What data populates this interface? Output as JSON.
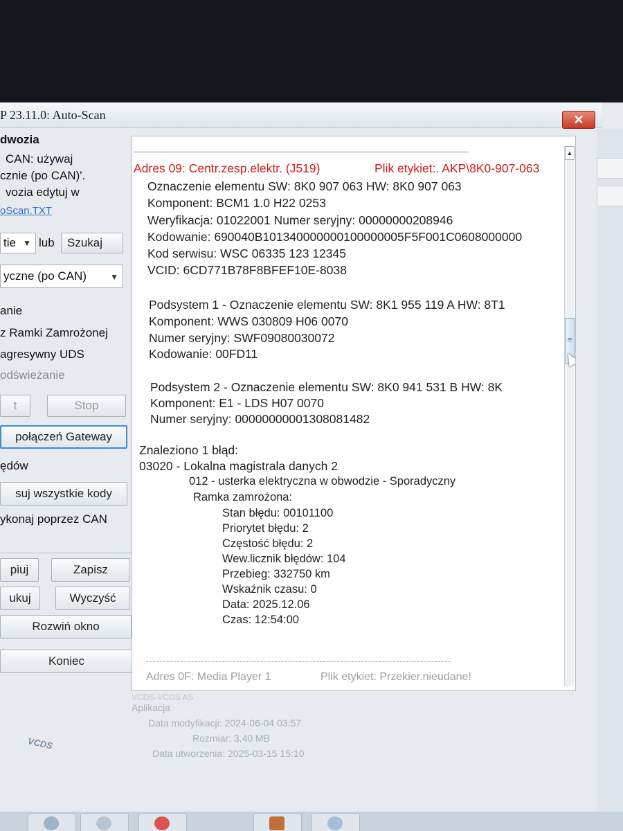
{
  "window": {
    "title": "P 23.11.0:  Auto-Scan",
    "close_symbol": "✕"
  },
  "left_panel": {
    "section_header": "dwozia",
    "info_lines": [
      "CAN: używaj",
      "cznie (po CAN)'.",
      "vozia edytuj w"
    ],
    "info_link": "oScan.TXT",
    "type_select": {
      "value": "tie"
    },
    "or_label": "lub",
    "search_button": "Szukaj",
    "protocol_select": {
      "value": "yczne (po CAN)"
    },
    "options_header": "anie",
    "options": [
      "z Ramki Zamrożonej",
      "agresywny UDS"
    ],
    "refresh_label": "odświeżanie",
    "start_button": "t",
    "stop_button": "Stop",
    "gateway_button": "połączeń Gateway",
    "errors_header": "ędów",
    "clear_all_button": "suj wszystkie kody",
    "via_can_label": "ykonaj poprzez CAN",
    "copy_button": "piuj",
    "save_button": "Zapisz",
    "print_button": "ukuj",
    "clear_button": "Wyczyść",
    "expand_button": "Rozwiń okno",
    "exit_button": "Koniec"
  },
  "report": {
    "header_address": "Adres 09: Centr.zesp.elektr. (J519)",
    "header_label_file": "Plik etykiet:. AKP\\8K0-907-063",
    "lines": [
      "Oznaczenie elementu SW: 8K0 907 063    HW: 8K0 907 063",
      "Komponent: BCM1 1.0      H22 0253",
      "Weryfikacja: 01022001    Numer seryjny: 00000000208946",
      "Kodowanie: 690040B101340000000100000005F5F001C0608000000",
      "Kod serwisu: WSC 06335 123 12345",
      "VCID: 6CD771B78F8BFEF10E-8038"
    ],
    "subsystem1": [
      "Podsystem 1 - Oznaczenie elementu SW: 8K1 955 119 A    HW: 8T1",
      "Komponent: WWS 030809  H06 0070",
      "Numer seryjny: SWF09080030072",
      "Kodowanie: 00FD11"
    ],
    "subsystem2": [
      "Podsystem 2 - Oznaczenie elementu SW: 8K0 941 531 B    HW: 8K",
      "Komponent: E1 - LDS  H07 0070",
      "Numer seryjny: 00000000001308081482"
    ],
    "found_errors": "Znaleziono 1 błąd:",
    "fault_code": "03020 - Lokalna magistrala danych 2",
    "fault_detail": "012 - usterka elektryczna w obwodzie - Sporadyczny",
    "freeze_frame_header": "Ramka zamrożona:",
    "freeze_frame": [
      "Stan błędu: 00101100",
      "Priorytet błędu: 2",
      "Częstość błędu: 2",
      "Wew.licznik błędów: 104",
      "Przebieg: 332750 km",
      "Wskaźnik czasu: 0",
      "Data: 2025.12.06",
      "Czas: 12:54:00"
    ],
    "next_address": "Adres 0F: Media Player 1",
    "next_label_file": "Plik etykiet: Przekier.nieudane!"
  },
  "file_info": {
    "truncated_name": "VCDS-VCDS AS",
    "type": "Aplikacja",
    "modified": "Data modyfikacji: 2024-06-04 03:57",
    "size": "Rozmiar: 3,40 MB",
    "created": "Data utworzenia: 2025-03-15 15:10",
    "logo_text": "VCDS"
  },
  "colors": {
    "address_red": "#d11a1a",
    "link_blue": "#2f6fc7",
    "close_red": "#c43b24"
  }
}
